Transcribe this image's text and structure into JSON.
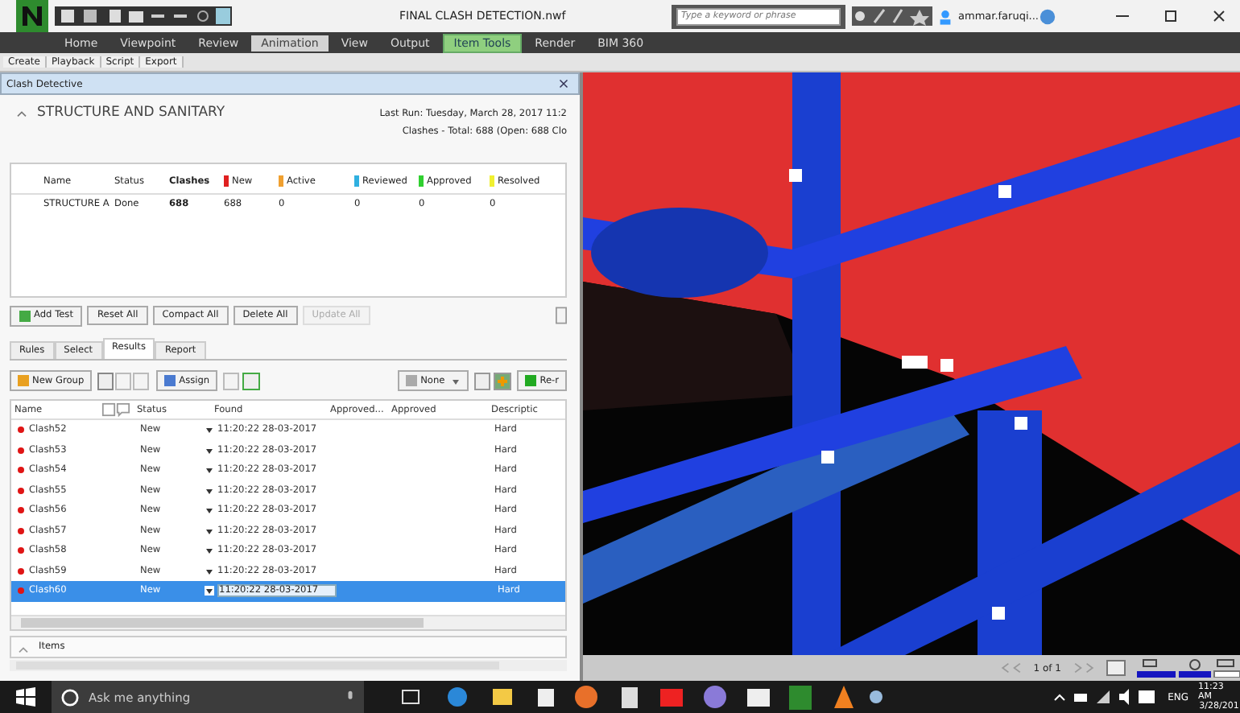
{
  "window": {
    "title": "FINAL CLASH DETECTION.nwf"
  },
  "search": {
    "placeholder": "Type a keyword or phrase"
  },
  "user": "ammar.faruqi...",
  "ribbon_tabs": [
    {
      "label": "Home",
      "selected": false,
      "kind": "normal"
    },
    {
      "label": "Viewpoint",
      "selected": false,
      "kind": "normal"
    },
    {
      "label": "Review",
      "selected": false,
      "kind": "normal"
    },
    {
      "label": "Animation",
      "selected": true,
      "kind": "normal"
    },
    {
      "label": "View",
      "selected": false,
      "kind": "normal"
    },
    {
      "label": "Output",
      "selected": false,
      "kind": "normal"
    },
    {
      "label": "Item Tools",
      "selected": false,
      "kind": "contextual"
    },
    {
      "label": "Render",
      "selected": false,
      "kind": "normal"
    },
    {
      "label": "BIM 360",
      "selected": false,
      "kind": "normal"
    }
  ],
  "ribbon_panels": [
    "Create",
    "Playback",
    "Script",
    "Export"
  ],
  "panel": {
    "title": "Clash Detective"
  },
  "test": {
    "name": "STRUCTURE AND SANITARY",
    "expanded": true,
    "last_run": "Last Run:  Tuesday, March 28, 2017 11:2",
    "summary": "Clashes - Total: 688  (Open: 688  Clo"
  },
  "tests_table": {
    "columns": [
      {
        "label": "Name",
        "kind": "plain"
      },
      {
        "label": "Status",
        "kind": "plain"
      },
      {
        "label": "Clashes",
        "kind": "total"
      },
      {
        "label": "New",
        "kind": "status",
        "color": "#e02020"
      },
      {
        "label": "Active",
        "kind": "status",
        "color": "#f0a030"
      },
      {
        "label": "Reviewed",
        "kind": "status",
        "color": "#30b0e0"
      },
      {
        "label": "Approved",
        "kind": "status",
        "color": "#30d030"
      },
      {
        "label": "Resolved",
        "kind": "status",
        "color": "#f0f030"
      }
    ],
    "rows": [
      {
        "cells": [
          "STRUCTURE A",
          "Done",
          "688",
          "688",
          "0",
          "0",
          "0",
          "0"
        ]
      }
    ]
  },
  "test_buttons": [
    {
      "label": "Add Test",
      "disabled": false
    },
    {
      "label": "Reset All",
      "disabled": false
    },
    {
      "label": "Compact All",
      "disabled": false
    },
    {
      "label": "Delete All",
      "disabled": false
    },
    {
      "label": "Update All",
      "disabled": true
    }
  ],
  "tabs": [
    {
      "label": "Rules",
      "selected": false
    },
    {
      "label": "Select",
      "selected": false
    },
    {
      "label": "Results",
      "selected": true
    },
    {
      "label": "Report",
      "selected": false
    }
  ],
  "results_toolbar": {
    "new_group": "New Group",
    "assign": "Assign",
    "filter": "None",
    "rerun": "Re-r"
  },
  "results": {
    "columns": [
      "Name",
      "Status",
      "Found",
      "Approved...",
      "Approved",
      "Descriptic"
    ],
    "rows": [
      {
        "name": "Clash52",
        "status": "New",
        "found": "11:20:22 28-03-2017",
        "description": "Hard",
        "selected": false
      },
      {
        "name": "Clash53",
        "status": "New",
        "found": "11:20:22 28-03-2017",
        "description": "Hard",
        "selected": false
      },
      {
        "name": "Clash54",
        "status": "New",
        "found": "11:20:22 28-03-2017",
        "description": "Hard",
        "selected": false
      },
      {
        "name": "Clash55",
        "status": "New",
        "found": "11:20:22 28-03-2017",
        "description": "Hard",
        "selected": false
      },
      {
        "name": "Clash56",
        "status": "New",
        "found": "11:20:22 28-03-2017",
        "description": "Hard",
        "selected": false
      },
      {
        "name": "Clash57",
        "status": "New",
        "found": "11:20:22 28-03-2017",
        "description": "Hard",
        "selected": false
      },
      {
        "name": "Clash58",
        "status": "New",
        "found": "11:20:22 28-03-2017",
        "description": "Hard",
        "selected": false
      },
      {
        "name": "Clash59",
        "status": "New",
        "found": "11:20:22 28-03-2017",
        "description": "Hard",
        "selected": false
      },
      {
        "name": "Clash60",
        "status": "New",
        "found": "11:20:22 28-03-2017",
        "description": "Hard",
        "selected": true
      }
    ]
  },
  "items_section": {
    "label": "Items",
    "expanded": false
  },
  "viewport_status": {
    "page": "1 of 1"
  },
  "taskbar": {
    "search_placeholder": "Ask me anything",
    "language": "ENG",
    "time": "11:23 AM",
    "date": "3/28/201"
  }
}
